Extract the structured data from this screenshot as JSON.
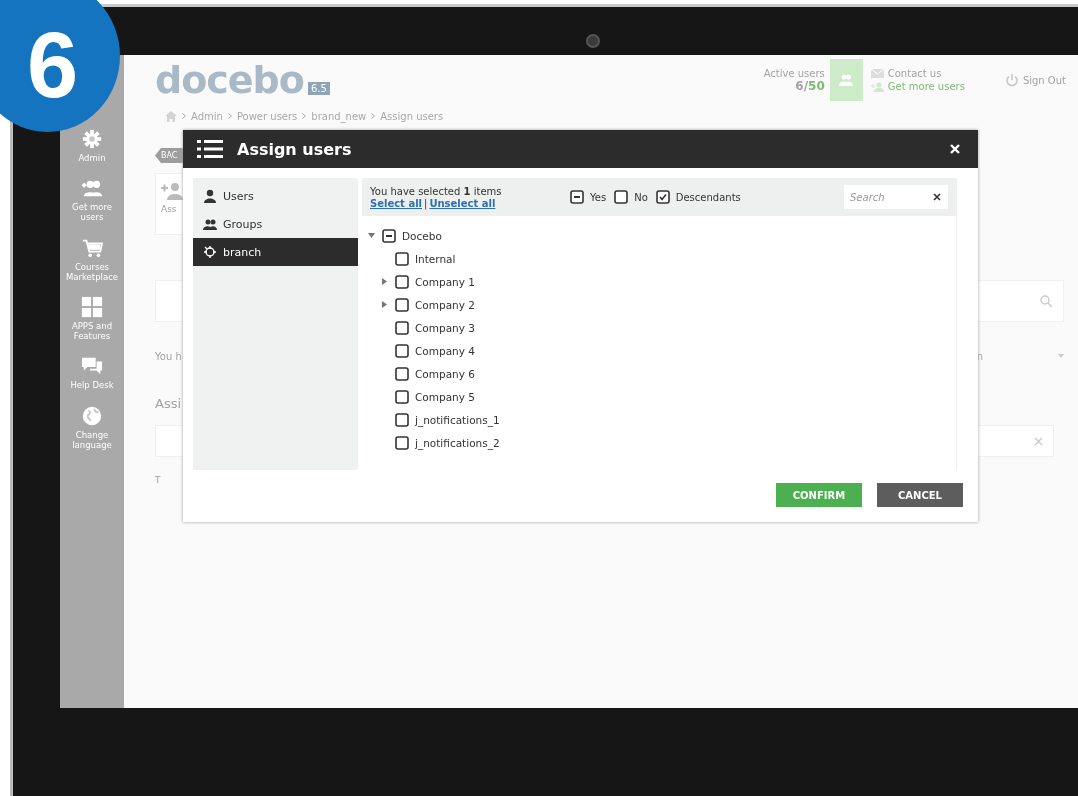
{
  "badge": {
    "number": "6"
  },
  "app": {
    "logo": "docebo",
    "version": "6.5",
    "active_users": {
      "label": "Active users",
      "used": "6/",
      "limit": "50"
    },
    "contact": "Contact us",
    "get_more": "Get more users",
    "sign_out": "Sign Out"
  },
  "breadcrumb": [
    "Admin",
    "Power users",
    "brand_new",
    "Assign users"
  ],
  "sidebar": [
    {
      "kind": "gear",
      "label": "Admin"
    },
    {
      "kind": "users",
      "label": "Get more users"
    },
    {
      "kind": "cart",
      "label": "Courses Marketplace"
    },
    {
      "kind": "apps",
      "label": "APPS and Features"
    },
    {
      "kind": "chat",
      "label": "Help Desk"
    },
    {
      "kind": "globe",
      "label": "Change language"
    }
  ],
  "background": {
    "back_button": "BAC",
    "tile_label": "Ass",
    "info_text": "You h",
    "dropdown_value": "n",
    "section_title": "Assi",
    "footer_text": "T"
  },
  "modal": {
    "title": "Assign users",
    "tabs": [
      {
        "kind": "user",
        "label": "Users",
        "selected": false
      },
      {
        "kind": "group",
        "label": "Groups",
        "selected": false
      },
      {
        "kind": "branch",
        "label": "branch",
        "selected": true
      }
    ],
    "selection": {
      "text": "You have selected **1** items",
      "select_all": "Select all",
      "separator": "|",
      "unselect_all": "Unselect all"
    },
    "legend": [
      {
        "label": "Yes",
        "checked": false,
        "indeterminate": true
      },
      {
        "label": "No",
        "checked": false,
        "indeterminate": false
      },
      {
        "label": "Descendants",
        "checked": true,
        "indeterminate": false
      }
    ],
    "search": {
      "placeholder": "Search"
    },
    "tree": [
      {
        "label": "Docebo",
        "checked": false,
        "indeterminate": true,
        "expanded": true,
        "children": [
          {
            "label": "Internal",
            "checked": false,
            "indeterminate": false
          },
          {
            "label": "Company 1",
            "checked": false,
            "indeterminate": false,
            "expanded": false
          },
          {
            "label": "Company 2",
            "checked": false,
            "indeterminate": false,
            "expanded": false
          },
          {
            "label": "Company 3",
            "checked": false,
            "indeterminate": false
          },
          {
            "label": "Company 4",
            "checked": false,
            "indeterminate": false
          },
          {
            "label": "Company 6",
            "checked": false,
            "indeterminate": false
          },
          {
            "label": "Company 5",
            "checked": false,
            "indeterminate": false
          },
          {
            "label": "j_notifications_1",
            "checked": false,
            "indeterminate": false
          },
          {
            "label": "j_notifications_2",
            "checked": false,
            "indeterminate": false
          }
        ]
      }
    ],
    "buttons": [
      {
        "kind": "primary",
        "label": "CONFIRM"
      },
      {
        "kind": "secondary",
        "label": "CANCEL"
      }
    ]
  }
}
